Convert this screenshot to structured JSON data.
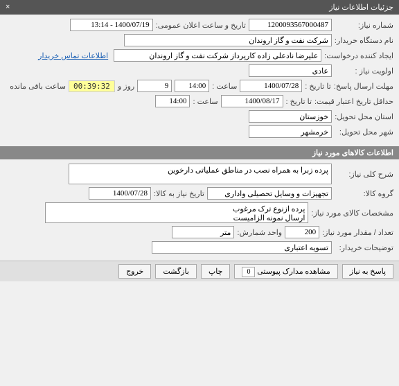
{
  "header": {
    "title": "جزئیات اطلاعات نیاز",
    "close": "×"
  },
  "need_info": {
    "request_no_label": "شماره نیاز:",
    "request_no": "1200093567000487",
    "announce_label": "تاریخ و ساعت اعلان عمومی:",
    "announce_value": "1400/07/19 - 13:14",
    "buyer_label": "نام دستگاه خریدار:",
    "buyer": "شرکت نفت و گاز اروندان",
    "creator_label": "ایجاد کننده درخواست:",
    "creator": "علیرضا نادعلی زاده کارپرداز شرکت نفت و گاز اروندان",
    "contact_link": "اطلاعات تماس خریدار",
    "priority_label": "اولویت نیاز :",
    "priority": "عادی",
    "deadline_label": "مهلت ارسال پاسخ:",
    "to_date_label": "تا تاریخ :",
    "to_date": "1400/07/28",
    "hour_label": "ساعت :",
    "hour": "14:00",
    "days_count": "9",
    "days_label": "روز و",
    "timer": "00:39:32",
    "remaining_label": "ساعت باقی مانده",
    "price_validity_label": "حداقل تاریخ اعتبار قیمت:",
    "price_to_date_label": "تا تاریخ :",
    "price_date": "1400/08/17",
    "price_hour_label": "ساعت :",
    "price_hour": "14:00",
    "province_label": "استان محل تحویل:",
    "province": "خوزستان",
    "city_label": "شهر محل تحویل:",
    "city": "خرمشهر"
  },
  "goods_section_title": "اطلاعات کالاهای مورد نیاز",
  "goods": {
    "desc_label": "شرح کلی نیاز:",
    "desc": "پرده زبرا به همراه نصب در مناطق عملیاتی دارخوین",
    "group_label": "گروه کالا:",
    "group": "تجهیزات و وسایل تحصیلی واداری",
    "need_date_label": "تاریخ نیاز به کالا:",
    "need_date": "1400/07/28",
    "spec_label": "مشخصات کالای مورد نیاز:",
    "spec": "پرده ازنوع ترک مرغوب\nارسال نمونه الزامیست",
    "qty_label": "تعداد / مقدار مورد نیاز:",
    "qty": "200",
    "unit_label": "واحد شمارش:",
    "unit": "متر",
    "buyer_note_label": "توضیحات خریدار:",
    "buyer_note": "تسویه اعتباری"
  },
  "footer": {
    "reply": "پاسخ به نیاز",
    "attachments": "مشاهده مدارک پیوستی",
    "attach_count": "0",
    "print": "چاپ",
    "back": "بازگشت",
    "exit": "خروج"
  }
}
